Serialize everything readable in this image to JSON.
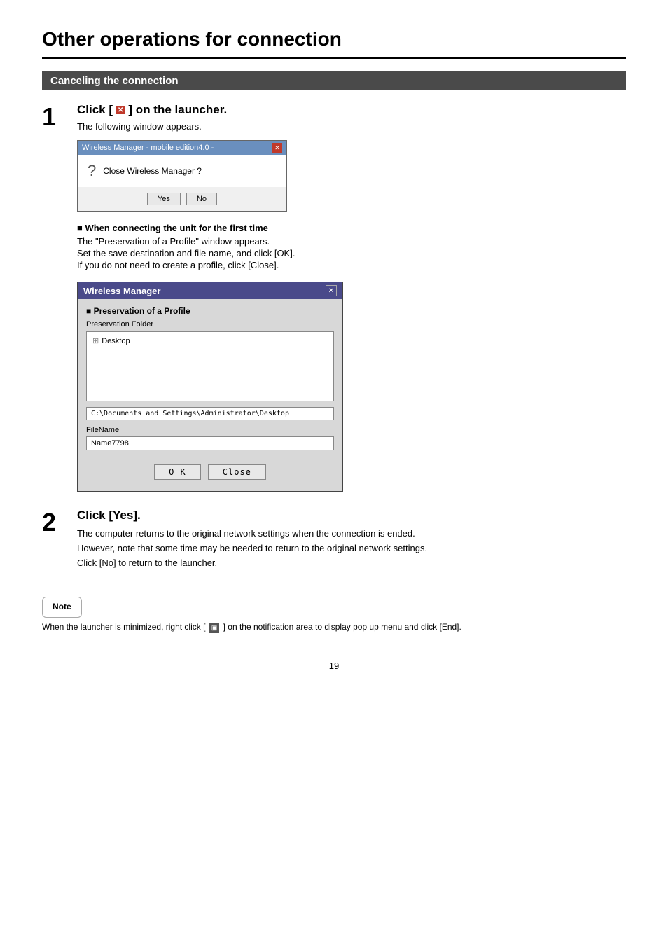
{
  "page": {
    "title": "Other operations for connection",
    "number": "19"
  },
  "section": {
    "heading": "Canceling the connection"
  },
  "step1": {
    "heading_pre": "Click [",
    "heading_icon": "✕",
    "heading_post": "] on the launcher.",
    "description": "The following window appears.",
    "dialog_small": {
      "title": "Wireless Manager - mobile edition4.0 -",
      "message": "Close Wireless Manager ?",
      "yes_label": "Yes",
      "no_label": "No"
    },
    "sub_heading": "When connecting the unit for the first time",
    "sub_texts": [
      "The \"Preservation of a Profile\" window appears.",
      "Set the save destination and file name, and click [OK].",
      "If you do not need to create a profile, click [Close]."
    ],
    "dialog_large": {
      "title": "Wireless Manager",
      "section_label": "■ Preservation of a Profile",
      "folder_label": "Preservation Folder",
      "folder_item": "Desktop",
      "path": "C:\\Documents and Settings\\Administrator\\Desktop",
      "filename_label": "FileName",
      "filename": "Name7798",
      "ok_label": "O K",
      "close_label": "Close"
    }
  },
  "step2": {
    "heading": "Click [Yes].",
    "lines": [
      "The computer returns to the original network settings when the connection is ended.",
      "However, note that some time may be needed to return to the original network settings.",
      "Click [No] to return to the launcher."
    ]
  },
  "note": {
    "label": "Note",
    "text": "When the launcher is minimized, right click [",
    "text_mid": "] on the notification area to display pop up menu and click [End]."
  }
}
